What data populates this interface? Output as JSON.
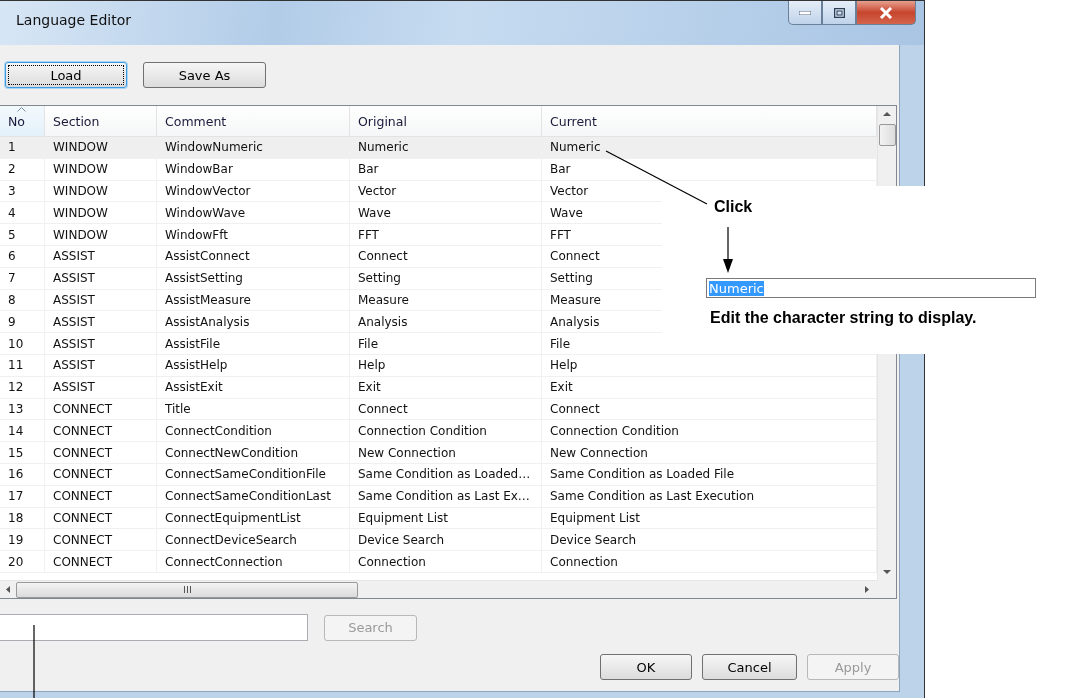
{
  "window": {
    "title": "Language Editor"
  },
  "toolbar": [
    {
      "label": "Load",
      "focused": true
    },
    {
      "label": "Save As",
      "focused": false
    }
  ],
  "table": {
    "columns": [
      {
        "label": "No",
        "sorted": true
      },
      {
        "label": "Section",
        "sorted": false
      },
      {
        "label": "Comment",
        "sorted": false
      },
      {
        "label": "Original",
        "sorted": false
      },
      {
        "label": "Current",
        "sorted": false
      }
    ],
    "rows": [
      {
        "cells": [
          "1",
          "WINDOW",
          "WindowNumeric",
          "Numeric",
          "Numeric"
        ],
        "selected": true
      },
      {
        "cells": [
          "2",
          "WINDOW",
          "WindowBar",
          "Bar",
          "Bar"
        ],
        "selected": false
      },
      {
        "cells": [
          "3",
          "WINDOW",
          "WindowVector",
          "Vector",
          "Vector"
        ],
        "selected": false
      },
      {
        "cells": [
          "4",
          "WINDOW",
          "WindowWave",
          "Wave",
          "Wave"
        ],
        "selected": false
      },
      {
        "cells": [
          "5",
          "WINDOW",
          "WindowFft",
          "FFT",
          "FFT"
        ],
        "selected": false
      },
      {
        "cells": [
          "6",
          "ASSIST",
          "AssistConnect",
          "Connect",
          "Connect"
        ],
        "selected": false
      },
      {
        "cells": [
          "7",
          "ASSIST",
          "AssistSetting",
          "Setting",
          "Setting"
        ],
        "selected": false
      },
      {
        "cells": [
          "8",
          "ASSIST",
          "AssistMeasure",
          "Measure",
          "Measure"
        ],
        "selected": false
      },
      {
        "cells": [
          "9",
          "ASSIST",
          "AssistAnalysis",
          "Analysis",
          "Analysis"
        ],
        "selected": false
      },
      {
        "cells": [
          "10",
          "ASSIST",
          "AssistFile",
          "File",
          "File"
        ],
        "selected": false
      },
      {
        "cells": [
          "11",
          "ASSIST",
          "AssistHelp",
          "Help",
          "Help"
        ],
        "selected": false
      },
      {
        "cells": [
          "12",
          "ASSIST",
          "AssistExit",
          "Exit",
          "Exit"
        ],
        "selected": false
      },
      {
        "cells": [
          "13",
          "CONNECT",
          "Title",
          "Connect",
          "Connect"
        ],
        "selected": false
      },
      {
        "cells": [
          "14",
          "CONNECT",
          "ConnectCondition",
          "Connection Condition",
          "Connection Condition"
        ],
        "selected": false
      },
      {
        "cells": [
          "15",
          "CONNECT",
          "ConnectNewCondition",
          "New Connection",
          "New Connection"
        ],
        "selected": false
      },
      {
        "cells": [
          "16",
          "CONNECT",
          "ConnectSameConditionFile",
          "Same Condition as Loaded…",
          "Same Condition as Loaded File"
        ],
        "selected": false
      },
      {
        "cells": [
          "17",
          "CONNECT",
          "ConnectSameConditionLast",
          "Same Condition as Last Ex…",
          "Same Condition as Last Execution"
        ],
        "selected": false
      },
      {
        "cells": [
          "18",
          "CONNECT",
          "ConnectEquipmentList",
          "Equipment List",
          "Equipment List"
        ],
        "selected": false
      },
      {
        "cells": [
          "19",
          "CONNECT",
          "ConnectDeviceSearch",
          "Device Search",
          "Device Search"
        ],
        "selected": false
      },
      {
        "cells": [
          "20",
          "CONNECT",
          "ConnectConnection",
          "Connection",
          "Connection"
        ],
        "selected": false
      }
    ]
  },
  "search": {
    "button": "Search",
    "disabled": true
  },
  "footer": [
    {
      "label": "OK",
      "disabled": false
    },
    {
      "label": "Cancel",
      "disabled": false
    },
    {
      "label": "Apply",
      "disabled": true
    }
  ],
  "annotation": {
    "click_label": "Click",
    "edit_value": "Numeric",
    "caption": "Edit the character string to display."
  }
}
